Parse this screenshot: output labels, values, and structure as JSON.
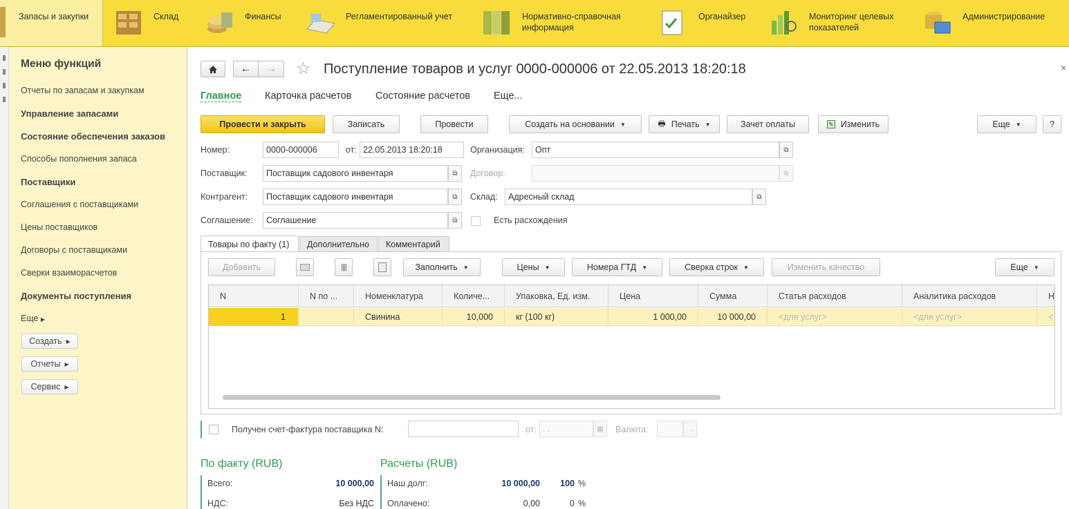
{
  "sections": [
    {
      "label": "Запасы и закупки",
      "icon": "stock-purchases-icon"
    },
    {
      "label": "Склад",
      "icon": "warehouse-icon"
    },
    {
      "label": "Финансы",
      "icon": "finance-icon"
    },
    {
      "label": "Регламентированный учет",
      "icon": "regulated-accounting-icon"
    },
    {
      "label": "Нормативно-справочная информация",
      "icon": "reference-info-icon"
    },
    {
      "label": "Органайзер",
      "icon": "organizer-icon"
    },
    {
      "label": "Мониторинг целевых показателей",
      "icon": "monitoring-icon"
    },
    {
      "label": "Администрирование",
      "icon": "administration-icon"
    }
  ],
  "sidebar": {
    "title": "Меню функций",
    "items": [
      {
        "label": "Отчеты по запасам и закупкам",
        "bold": false
      },
      {
        "label": "Управление запасами",
        "bold": true
      },
      {
        "label": "Состояние обеспечения заказов",
        "bold": true
      },
      {
        "label": "Способы пополнения запаса",
        "bold": false
      },
      {
        "label": "Поставщики",
        "bold": true
      },
      {
        "label": "Соглашения с поставщиками",
        "bold": false
      },
      {
        "label": "Цены поставщиков",
        "bold": false
      },
      {
        "label": "Договоры с поставщиками",
        "bold": false
      },
      {
        "label": "Сверки взаиморасчетов",
        "bold": false
      },
      {
        "label": "Документы поступления",
        "bold": true
      }
    ],
    "more": "Еще",
    "buttons": [
      "Создать",
      "Отчеты",
      "Сервис"
    ]
  },
  "document": {
    "title": "Поступление товаров и услуг 0000-000006 от 22.05.2013 18:20:18",
    "tabs": [
      "Главное",
      "Карточка расчетов",
      "Состояние расчетов",
      "Еще..."
    ]
  },
  "toolbar": {
    "post_close": "Провести и закрыть",
    "save": "Записать",
    "post": "Провести",
    "create_based": "Создать на основании",
    "print": "Печать",
    "offset_payment": "Зачет оплаты",
    "edit": "Изменить",
    "more": "Еще",
    "help": "?"
  },
  "form": {
    "number_label": "Номер:",
    "number": "0000-000006",
    "date_label": "от:",
    "date": "22.05.2013 18:20:18",
    "org_label": "Организация:",
    "org": "Опт",
    "supplier_label": "Поставщик:",
    "supplier": "Поставщик садового инвентаря",
    "contract_label": "Договор:",
    "contract": "",
    "counterparty_label": "Контрагент:",
    "counterparty": "Поставщик садового инвентаря",
    "warehouse_label": "Склад:",
    "warehouse": "Адресный склад",
    "agreement_label": "Соглашение:",
    "agreement": "Соглашение",
    "discrepancy_label": "Есть расхождения"
  },
  "inner_tabs": [
    "Товары по факту (1)",
    "Дополнительно",
    "Комментарий"
  ],
  "table_toolbar": {
    "add": "Добавить",
    "fill": "Заполнить",
    "prices": "Цены",
    "gtd": "Номера ГТД",
    "reconcile": "Сверка строк",
    "change_quality": "Изменить качество",
    "more": "Еще"
  },
  "table": {
    "columns": [
      "N",
      "N по ...",
      "Номенклатура",
      "Количе...",
      "Упаковка, Ед. изм.",
      "Цена",
      "Сумма",
      "Статья расходов",
      "Аналитика расходов",
      "Н"
    ],
    "rows": [
      {
        "n": "1",
        "n_po": "",
        "item": "Свинина",
        "qty": "10,000",
        "pack": "кг (100 кг)",
        "price": "1 000,00",
        "sum": "10 000,00",
        "expense": "<для услуг>",
        "analytics": "<для услуг>",
        "last": "<"
      }
    ]
  },
  "invoice": {
    "label": "Получен счет-фактура поставщика N:",
    "number": "",
    "date_label": "от:",
    "date_placeholder": ". .",
    "currency_label": "Валюта:",
    "currency": ""
  },
  "totals": {
    "fact_title": "По факту (RUB)",
    "total_label": "Всего:",
    "total": "10 000,00",
    "vat_label": "НДС:",
    "vat": "Без НДС",
    "calc_title": "Расчеты (RUB)",
    "debt_label": "Наш долг:",
    "debt": "10 000,00",
    "debt_pct": "100",
    "paid_label": "Оплачено:",
    "paid": "0,00",
    "paid_pct": "0",
    "pct_sign": "%"
  },
  "colors": {
    "topbar": "#f8dc3c",
    "sidebar": "#fbf5c8",
    "accent_green": "#2c9b4f",
    "primary_button": "#f1c517",
    "selected_row": "#fbf2c0"
  }
}
